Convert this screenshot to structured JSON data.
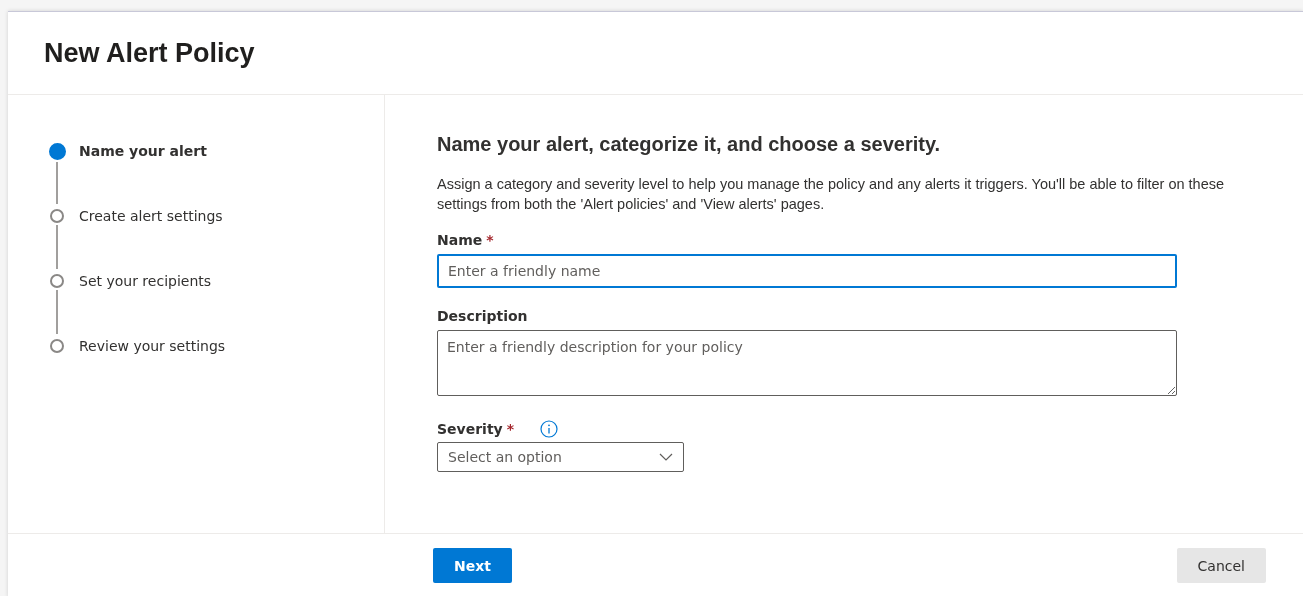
{
  "panel": {
    "title": "New Alert Policy"
  },
  "steps": [
    {
      "label": "Name your alert",
      "selected": true
    },
    {
      "label": "Create alert settings",
      "selected": false
    },
    {
      "label": "Set your recipients",
      "selected": false
    },
    {
      "label": "Review your settings",
      "selected": false
    }
  ],
  "heading": "Name your alert, categorize it, and choose a severity.",
  "intro": "Assign a category and severity level to help you manage the policy and any alerts it triggers. You'll be able to filter on these settings from both the 'Alert policies' and 'View alerts' pages.",
  "fields": [
    {
      "kind": "text",
      "label": "Name",
      "required_mark": "*",
      "focused": true,
      "placeholder": "Enter a friendly name"
    },
    {
      "kind": "textarea",
      "label": "Description",
      "focused": false,
      "placeholder": "Enter a friendly description for your policy"
    },
    {
      "kind": "select",
      "label": "Severity",
      "required_mark": "*",
      "focused": false,
      "info": true,
      "placeholder": "Select an option"
    }
  ],
  "footer": {
    "primary": "Next",
    "secondary": "Cancel"
  }
}
